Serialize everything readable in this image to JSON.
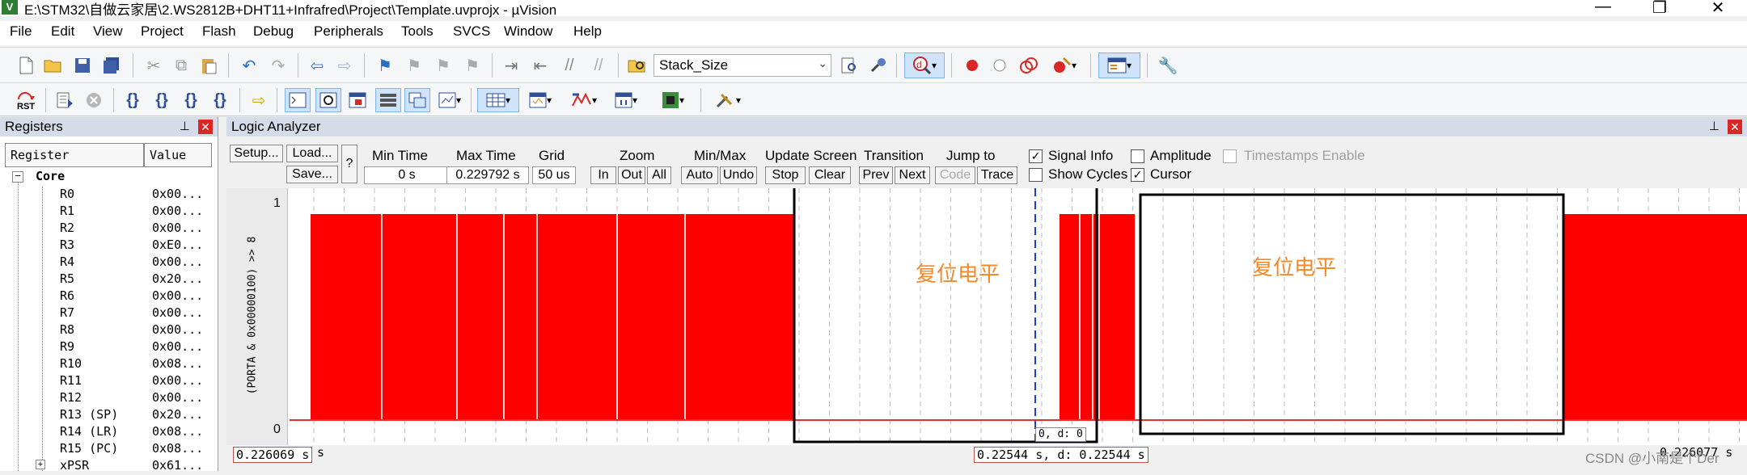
{
  "window": {
    "title": "E:\\STM32\\自做云家居\\2.WS2812B+DHT11+Infrafred\\Project\\Template.uvprojx - µVision",
    "app_icon": "V",
    "controls": {
      "minimize": "—",
      "maximize": "❐",
      "close": "✕"
    }
  },
  "menu": [
    "File",
    "Edit",
    "View",
    "Project",
    "Flash",
    "Debug",
    "Peripherals",
    "Tools",
    "SVCS",
    "Window",
    "Help"
  ],
  "toolbar": {
    "combo_value": "Stack_Size",
    "rst_label": "RST"
  },
  "registers": {
    "title": "Registers",
    "pin": "📌",
    "close": "✕",
    "columns": [
      "Register",
      "Value"
    ],
    "group": "Core",
    "expand": "−",
    "rows": [
      {
        "name": "R0",
        "value": "0x00..."
      },
      {
        "name": "R1",
        "value": "0x00..."
      },
      {
        "name": "R2",
        "value": "0x00..."
      },
      {
        "name": "R3",
        "value": "0xE0..."
      },
      {
        "name": "R4",
        "value": "0x00..."
      },
      {
        "name": "R5",
        "value": "0x20..."
      },
      {
        "name": "R6",
        "value": "0x00..."
      },
      {
        "name": "R7",
        "value": "0x00..."
      },
      {
        "name": "R8",
        "value": "0x00..."
      },
      {
        "name": "R9",
        "value": "0x00..."
      },
      {
        "name": "R10",
        "value": "0x08..."
      },
      {
        "name": "R11",
        "value": "0x00..."
      },
      {
        "name": "R12",
        "value": "0x00..."
      },
      {
        "name": "R13 (SP)",
        "value": "0x20..."
      },
      {
        "name": "R14 (LR)",
        "value": "0x08..."
      },
      {
        "name": "R15 (PC)",
        "value": "0x08..."
      },
      {
        "name": "xPSR",
        "value": "0x61..."
      }
    ]
  },
  "logic_analyzer": {
    "title": "Logic Analyzer",
    "pin": "📌",
    "close": "✕",
    "buttons": {
      "setup": "Setup...",
      "load": "Load...",
      "save": "Save...",
      "help": "?",
      "zoom_in": "In",
      "zoom_out": "Out",
      "zoom_all": "All",
      "minmax_auto": "Auto",
      "minmax_undo": "Undo",
      "update_stop": "Stop",
      "update_clear": "Clear",
      "transition_prev": "Prev",
      "transition_next": "Next",
      "jump_code": "Code",
      "jump_trace": "Trace"
    },
    "labels": {
      "min_time": "Min Time",
      "max_time": "Max Time",
      "grid": "Grid",
      "zoom": "Zoom",
      "minmax": "Min/Max",
      "update_screen": "Update Screen",
      "transition": "Transition",
      "jump_to": "Jump to",
      "signal_info": "Signal Info",
      "show_cycles": "Show Cycles",
      "amplitude": "Amplitude",
      "cursor": "Cursor",
      "timestamps_enable": "Timestamps Enable"
    },
    "values": {
      "min_time": "0 s",
      "max_time": "0.229792 s",
      "grid": "50 us"
    },
    "checks": {
      "signal_info": true,
      "show_cycles": false,
      "amplitude": false,
      "cursor": true,
      "timestamps_enable": false
    },
    "signal_name": "(PORTA & 0x00000100) >> 8",
    "y_max": "1",
    "y_min": "0",
    "annotation_left": "复位电平",
    "annotation_right": "复位电平",
    "cursor_small_label": "0,  d: 0",
    "time_left": "0.226069 s",
    "time_left_suffix": "s",
    "time_cursor": "0.22544 s,  d: 0.22544 s",
    "time_right": "0.226077 s",
    "watermark": "CSDN @小南是个Der"
  }
}
